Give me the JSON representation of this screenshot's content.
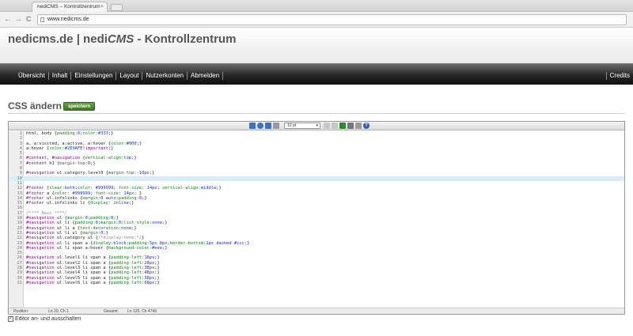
{
  "browser": {
    "tab_title": "nediCMS – Kontrollzentrum",
    "tab_close": "×",
    "url": "www.nedicms.de",
    "back": "←",
    "forward": "→",
    "reload": "C"
  },
  "header": {
    "title_prefix": "nedicms.de | nedi",
    "title_cms": "CMS",
    "title_suffix": " - Kontrollzentrum"
  },
  "nav": {
    "items": [
      "Übersicht",
      "Inhalt",
      "Einstellungen",
      "Layout",
      "Nutzerkonten",
      "Abmelden"
    ],
    "credits": "Credits"
  },
  "page": {
    "title": "CSS ändern",
    "save_label": "speichern"
  },
  "toolbar": {
    "font_size": "10 pt",
    "icons": [
      "search-icon",
      "replace-icon",
      "fullscreen-icon",
      "monitor-icon",
      "font-size-select",
      "undo-icon",
      "redo-icon",
      "highlight-icon",
      "pen-icon",
      "reset-icon",
      "help-icon"
    ],
    "colors": {
      "blue": "#3a72c4",
      "gray": "#9a9a9a",
      "green": "#2d8a2d",
      "help": "#2a5fc0"
    }
  },
  "code_lines": [
    [
      [
        "html, body ",
        "s"
      ],
      [
        "{",
        "s"
      ],
      [
        "padding:",
        "p"
      ],
      [
        "0",
        "v"
      ],
      [
        ";",
        "s"
      ],
      [
        "color:",
        "p"
      ],
      [
        "#333",
        "v"
      ],
      [
        ";}",
        "s"
      ]
    ],
    [],
    [
      [
        "a, a:visited, a:active, a:hover ",
        "s"
      ],
      [
        "{",
        "s"
      ],
      [
        "color:",
        "p"
      ],
      [
        "#000",
        "v"
      ],
      [
        ";}",
        "s"
      ]
    ],
    [
      [
        "a:hover ",
        "s"
      ],
      [
        "{",
        "s"
      ],
      [
        "color:",
        "p"
      ],
      [
        "#2E9AFE",
        "v"
      ],
      [
        "!important",
        "h"
      ],
      [
        ";}",
        "s"
      ]
    ],
    [],
    [
      [
        "#content",
        "h"
      ],
      [
        ", ",
        "s"
      ],
      [
        "#navigation",
        "h"
      ],
      [
        " {",
        "s"
      ],
      [
        "vertical-align:",
        "p"
      ],
      [
        "top",
        "v"
      ],
      [
        ";}",
        "s"
      ]
    ],
    [
      [
        "#content",
        "h"
      ],
      [
        " h1 {",
        "s"
      ],
      [
        "margin-top:",
        "p"
      ],
      [
        "0",
        "v"
      ],
      [
        ";}",
        "s"
      ]
    ],
    [],
    [
      [
        "#navigation",
        "h"
      ],
      [
        " ul.category.level0 {",
        "s"
      ],
      [
        "margin-top:",
        "p"
      ],
      [
        "-10px",
        "v"
      ],
      [
        ";}",
        "s"
      ]
    ],
    [],
    [],
    [
      [
        "#footer",
        "h"
      ],
      [
        " {",
        "s"
      ],
      [
        "clear:",
        "p"
      ],
      [
        "both",
        "v"
      ],
      [
        ";",
        "s"
      ],
      [
        "color: ",
        "p"
      ],
      [
        "#999999",
        "v"
      ],
      [
        "; ",
        "s"
      ],
      [
        "font-size: ",
        "p"
      ],
      [
        "14px",
        "v"
      ],
      [
        "; ",
        "s"
      ],
      [
        "vertical-align:",
        "p"
      ],
      [
        "middle",
        "v"
      ],
      [
        ";}",
        "s"
      ]
    ],
    [
      [
        "#footer",
        "h"
      ],
      [
        " a {",
        "s"
      ],
      [
        "color: ",
        "p"
      ],
      [
        "#999999",
        "v"
      ],
      [
        "; ",
        "s"
      ],
      [
        "font-size: ",
        "p"
      ],
      [
        "14px",
        "v"
      ],
      [
        "; }",
        "s"
      ]
    ],
    [
      [
        "#footer",
        "h"
      ],
      [
        " ul.infolinks {",
        "s"
      ],
      [
        "margin:",
        "p"
      ],
      [
        "0 auto",
        "v"
      ],
      [
        ";",
        "s"
      ],
      [
        "padding:",
        "p"
      ],
      [
        "0",
        "v"
      ],
      [
        ";}",
        "s"
      ]
    ],
    [
      [
        "#footer",
        "h"
      ],
      [
        " ul.infolinks li {",
        "s"
      ],
      [
        "display: ",
        "p"
      ],
      [
        "inline",
        "v"
      ],
      [
        ";}",
        "s"
      ]
    ],
    [],
    [
      [
        "/**** Navi ****/",
        "c"
      ]
    ],
    [
      [
        "#navigation",
        "h"
      ],
      [
        " ul {",
        "s"
      ],
      [
        "margin:",
        "p"
      ],
      [
        "0",
        "v"
      ],
      [
        ";",
        "s"
      ],
      [
        "padding:",
        "p"
      ],
      [
        "0",
        "v"
      ],
      [
        ";}",
        "s"
      ]
    ],
    [
      [
        "#navigation",
        "h"
      ],
      [
        " ul li {",
        "s"
      ],
      [
        "padding:",
        "p"
      ],
      [
        "0",
        "v"
      ],
      [
        ";",
        "s"
      ],
      [
        "margin:",
        "p"
      ],
      [
        "0",
        "v"
      ],
      [
        ";",
        "s"
      ],
      [
        "list-style:",
        "p"
      ],
      [
        "none",
        "v"
      ],
      [
        ";}",
        "s"
      ]
    ],
    [
      [
        "#navigation",
        "h"
      ],
      [
        " ul li a {",
        "s"
      ],
      [
        "text-decoration:",
        "p"
      ],
      [
        "none",
        "v"
      ],
      [
        ";}",
        "s"
      ]
    ],
    [
      [
        "#navigation",
        "h"
      ],
      [
        " ul li ul {",
        "s"
      ],
      [
        "margin:",
        "p"
      ],
      [
        "0",
        "v"
      ],
      [
        ";}",
        "s"
      ]
    ],
    [
      [
        "#navigation",
        "h"
      ],
      [
        " ul.category ul {",
        "s"
      ],
      [
        "/*display:none;*/",
        "c"
      ],
      [
        "}",
        "s"
      ]
    ],
    [
      [
        "#navigation",
        "h"
      ],
      [
        " ul li span a {",
        "s"
      ],
      [
        "display:",
        "p"
      ],
      [
        "block",
        "v"
      ],
      [
        ";",
        "s"
      ],
      [
        "padding:",
        "p"
      ],
      [
        "5px 8px",
        "v"
      ],
      [
        ";",
        "s"
      ],
      [
        "border-bottom:",
        "p"
      ],
      [
        "1px dashed #ccc",
        "v"
      ],
      [
        ";}",
        "s"
      ]
    ],
    [
      [
        "#navigation",
        "h"
      ],
      [
        " ul li span a:hover {",
        "s"
      ],
      [
        "background-color:",
        "p"
      ],
      [
        "#eee",
        "v"
      ],
      [
        ";}",
        "s"
      ]
    ],
    [],
    [
      [
        "#navigation",
        "h"
      ],
      [
        " ul.level1 li span a {",
        "s"
      ],
      [
        "padding-left:",
        "p"
      ],
      [
        "18px",
        "v"
      ],
      [
        ";}",
        "s"
      ]
    ],
    [
      [
        "#navigation",
        "h"
      ],
      [
        " ul.level2 li span a {",
        "s"
      ],
      [
        "padding-left:",
        "p"
      ],
      [
        "28px",
        "v"
      ],
      [
        ";}",
        "s"
      ]
    ],
    [
      [
        "#navigation",
        "h"
      ],
      [
        " ul.level3 li span a {",
        "s"
      ],
      [
        "padding-left:",
        "p"
      ],
      [
        "38px",
        "v"
      ],
      [
        ";}",
        "s"
      ]
    ],
    [
      [
        "#navigation",
        "h"
      ],
      [
        " ul.level4 li span a {",
        "s"
      ],
      [
        "padding-left:",
        "p"
      ],
      [
        "48px",
        "v"
      ],
      [
        ";}",
        "s"
      ]
    ],
    [
      [
        "#navigation",
        "h"
      ],
      [
        " ul.level5 li span a {",
        "s"
      ],
      [
        "padding-left:",
        "p"
      ],
      [
        "58px",
        "v"
      ],
      [
        ";}",
        "s"
      ]
    ],
    [
      [
        "#navigation",
        "h"
      ],
      [
        " ul.level6 li span a {",
        "s"
      ],
      [
        "padding-left:",
        "p"
      ],
      [
        "68px",
        "v"
      ],
      [
        ";}",
        "s"
      ]
    ]
  ],
  "current_line": 10,
  "status": {
    "position_label": "Position:",
    "position_value": "Ln 10, Ch 1",
    "total_label": "Gesamt:",
    "total_value": "Ln 125, Ch 4749"
  },
  "editor_toggle": {
    "label": "Editor an- und ausschalten",
    "checked_mark": "✓"
  }
}
